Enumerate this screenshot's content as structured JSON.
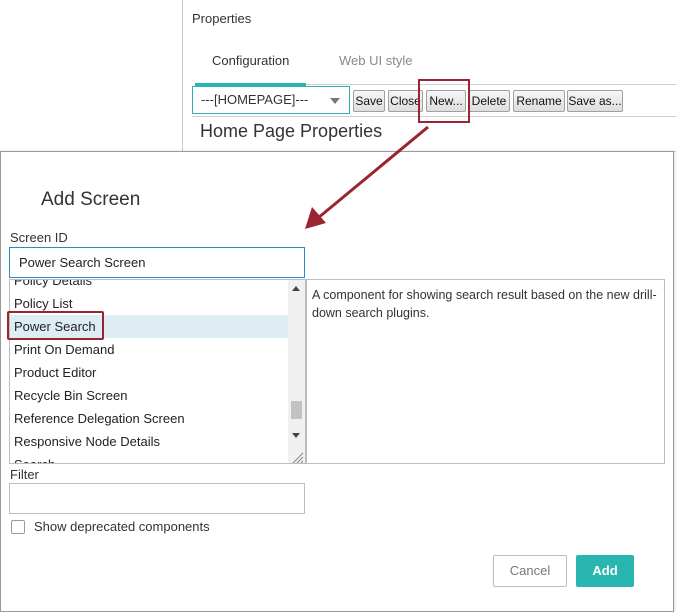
{
  "properties_panel": {
    "title": "Properties",
    "tabs": [
      {
        "label": "Configuration",
        "active": true
      },
      {
        "label": "Web UI style",
        "active": false
      }
    ],
    "homepage_select": {
      "value": "---[HOMEPAGE]---"
    },
    "toolbar_buttons": [
      {
        "label": "Save"
      },
      {
        "label": "Close"
      },
      {
        "label": "New..."
      },
      {
        "label": "Delete"
      },
      {
        "label": "Rename"
      },
      {
        "label": "Save as..."
      }
    ],
    "section_heading": "Home Page Properties"
  },
  "dialog": {
    "title": "Add Screen",
    "screen_id": {
      "label": "Screen ID",
      "value": "Power Search Screen"
    },
    "components": [
      {
        "label": "Policy Details"
      },
      {
        "label": "Policy List"
      },
      {
        "label": "Power Search",
        "selected": true
      },
      {
        "label": "Print On Demand"
      },
      {
        "label": "Product Editor"
      },
      {
        "label": "Recycle Bin Screen"
      },
      {
        "label": "Reference Delegation Screen"
      },
      {
        "label": "Responsive Node Details"
      },
      {
        "label": "Search"
      }
    ],
    "description": "A component for showing search result based on the new drill-down search plugins.",
    "filter": {
      "label": "Filter",
      "value": ""
    },
    "deprecated_checkbox": {
      "label": "Show deprecated components",
      "checked": false
    },
    "cancel_label": "Cancel",
    "add_label": "Add"
  },
  "colors": {
    "accent": "#29b6b0",
    "annotation": "#9a2530",
    "selection": "#deedf4",
    "input_focus": "#2f89c6"
  }
}
